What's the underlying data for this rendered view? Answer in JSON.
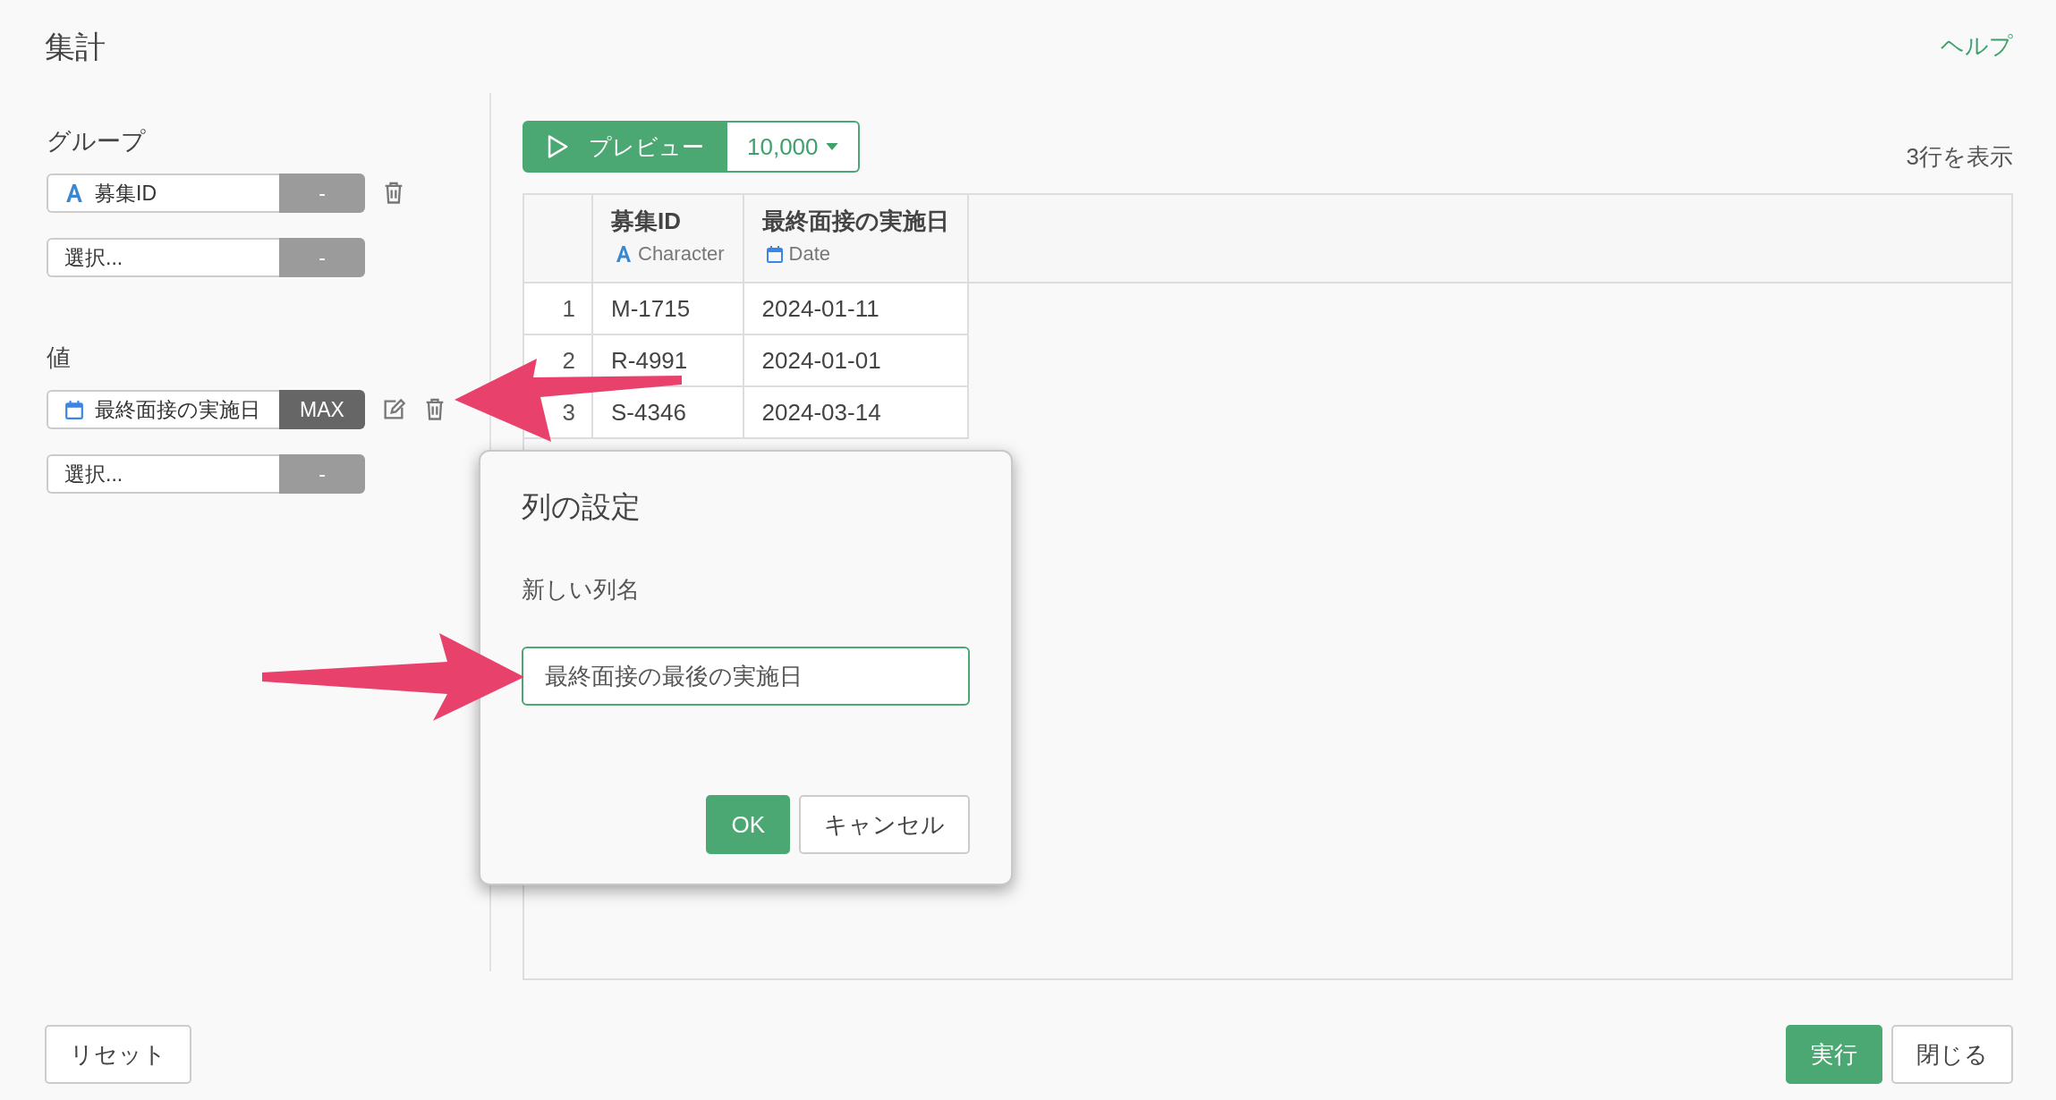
{
  "header": {
    "title": "集計",
    "help_link": "ヘルプ"
  },
  "group": {
    "label": "グループ",
    "rows": [
      {
        "kind": "character",
        "name": "募集ID",
        "function": "-",
        "function_set": false
      },
      {
        "kind": "empty",
        "placeholder": "選択...",
        "function": "-",
        "function_set": false
      }
    ]
  },
  "values": {
    "label": "値",
    "rows": [
      {
        "kind": "date",
        "name": "最終面接の実施日",
        "function": "MAX",
        "function_set": true,
        "editable": true
      },
      {
        "kind": "empty",
        "placeholder": "選択...",
        "function": "-",
        "function_set": false
      }
    ]
  },
  "preview": {
    "label": "プレビュー",
    "row_limit": "10,000",
    "row_count": "3行を表示"
  },
  "table": {
    "columns": [
      {
        "name": "募集ID",
        "kind": "character",
        "type_label": "Character"
      },
      {
        "name": "最終面接の実施日",
        "kind": "date",
        "type_label": "Date"
      }
    ],
    "rows": [
      {
        "number": "1",
        "cells": [
          "M-1715",
          "2024-01-11"
        ]
      },
      {
        "number": "2",
        "cells": [
          "R-4991",
          "2024-01-01"
        ]
      },
      {
        "number": "3",
        "cells": [
          "S-4346",
          "2024-03-14"
        ]
      }
    ]
  },
  "dialog": {
    "title": "列の設定",
    "field_label": "新しい列名",
    "value": "最終面接の最後の実施日",
    "buttons": [
      {
        "label": "OK",
        "kind": "primary"
      },
      {
        "label": "キャンセル",
        "kind": "secondary"
      }
    ]
  },
  "footer": {
    "reset": "リセット",
    "buttons": [
      {
        "label": "実行",
        "kind": "primary"
      },
      {
        "label": "閉じる",
        "kind": "secondary"
      }
    ]
  }
}
